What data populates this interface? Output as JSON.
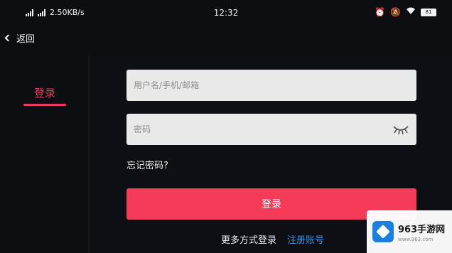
{
  "status_bar": {
    "network_speed": "2.50KB/s",
    "time": "12:32",
    "battery": "81"
  },
  "nav": {
    "back_label": "返回"
  },
  "sidebar": {
    "active_tab": "登录"
  },
  "form": {
    "username_placeholder": "用户名/手机/邮箱",
    "password_placeholder": "密码",
    "forgot_label": "忘记密码?",
    "login_button": "登录",
    "more_login_label": "更多方式登录",
    "register_label": "注册账号"
  },
  "watermark": {
    "title": "963手游网",
    "subtitle": "www.963.com"
  },
  "colors": {
    "accent": "#f53b57",
    "link": "#3b8fe0",
    "background": "#0c0e12"
  }
}
